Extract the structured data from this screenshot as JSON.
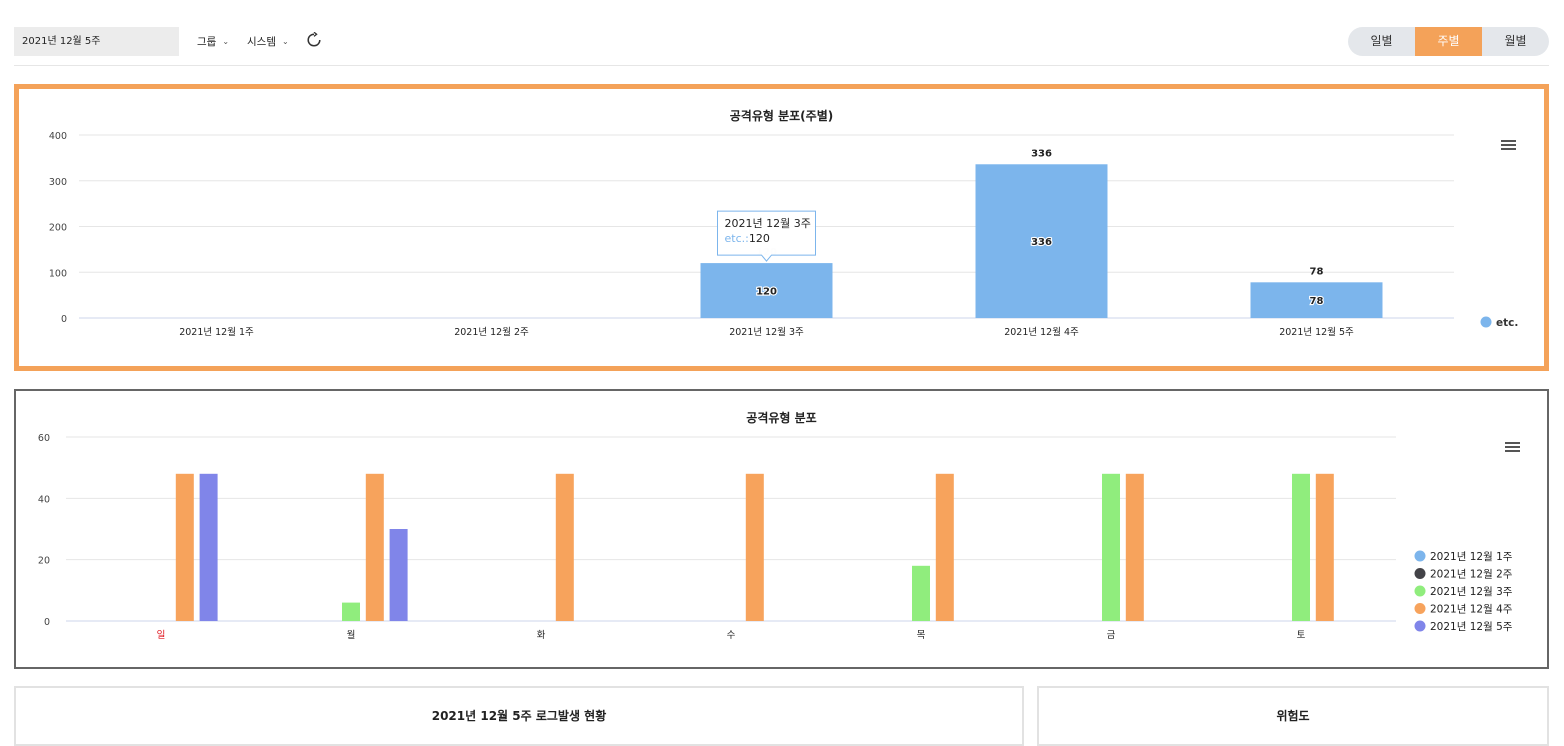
{
  "toolbar": {
    "date_value": "2021년 12월 5주",
    "group_label": "그룹",
    "system_label": "시스템",
    "tabs": [
      {
        "label": "일별",
        "active": false
      },
      {
        "label": "주별",
        "active": true
      },
      {
        "label": "월별",
        "active": false
      }
    ]
  },
  "colors": {
    "accent": "#f4a259",
    "etc": "#7cb5ec",
    "week1": "#7cb5ec",
    "week2": "#434348",
    "week3": "#90ed7d",
    "week4": "#f7a35c",
    "week5": "#8085e9",
    "sunday": "#e0101a"
  },
  "chart_data": [
    {
      "type": "bar",
      "title": "공격유형 분포(주별)",
      "categories": [
        "2021년 12월 1주",
        "2021년 12월 2주",
        "2021년 12월 3주",
        "2021년 12월 4주",
        "2021년 12월 5주"
      ],
      "series": [
        {
          "name": "etc.",
          "values": [
            0,
            0,
            120,
            336,
            78
          ]
        }
      ],
      "ylim": [
        0,
        400
      ],
      "yticks": [
        "0",
        "100",
        "200",
        "300",
        "400"
      ],
      "grid": true,
      "legend": "right",
      "tooltip": {
        "title": "2021년 12월 3주",
        "series": "etc.",
        "value": "120"
      }
    },
    {
      "type": "bar",
      "title": "공격유형 분포",
      "categories": [
        "일",
        "월",
        "화",
        "수",
        "목",
        "금",
        "토"
      ],
      "series": [
        {
          "name": "2021년 12월 1주",
          "values": [
            0,
            0,
            0,
            0,
            0,
            0,
            0
          ]
        },
        {
          "name": "2021년 12월 2주",
          "values": [
            0,
            0,
            0,
            0,
            0,
            0,
            0
          ]
        },
        {
          "name": "2021년 12월 3주",
          "values": [
            0,
            6,
            0,
            0,
            18,
            48,
            48
          ]
        },
        {
          "name": "2021년 12월 4주",
          "values": [
            48,
            48,
            48,
            48,
            48,
            48,
            48
          ]
        },
        {
          "name": "2021년 12월 5주",
          "values": [
            48,
            30,
            0,
            0,
            0,
            0,
            0
          ]
        }
      ],
      "ylim": [
        0,
        60
      ],
      "yticks": [
        "0",
        "20",
        "40",
        "60"
      ],
      "grid": true,
      "legend": "right"
    }
  ],
  "bottom": {
    "log_title": "2021년 12월 5주 로그발생 현황",
    "risk_title": "위험도"
  }
}
